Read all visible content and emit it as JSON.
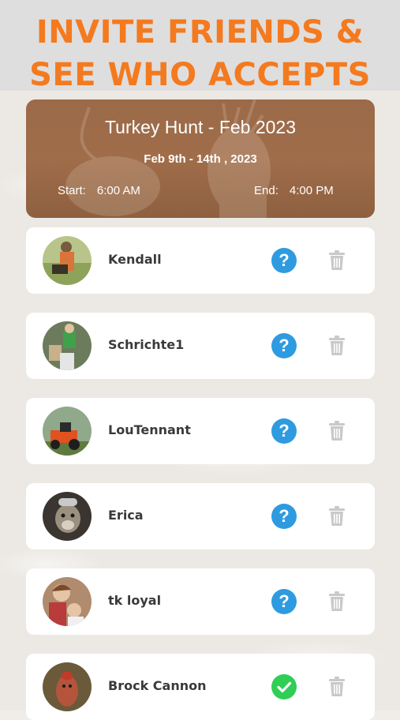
{
  "headline": {
    "line1": "INVITE FRIENDS &",
    "line2": "SEE WHO ACCEPTS",
    "color": "#f47a1f"
  },
  "event": {
    "title": "Turkey Hunt - Feb 2023",
    "dates": "Feb 9th - 14th , 2023",
    "start_label": "Start:",
    "start_time": "6:00 AM",
    "end_label": "End:",
    "end_time": "4:00 PM"
  },
  "invitees": [
    {
      "name": "Kendall",
      "status": "pending",
      "status_icon": "question-icon"
    },
    {
      "name": "Schrichte1",
      "status": "pending",
      "status_icon": "question-icon"
    },
    {
      "name": "LouTennant",
      "status": "pending",
      "status_icon": "question-icon"
    },
    {
      "name": "Erica",
      "status": "pending",
      "status_icon": "question-icon"
    },
    {
      "name": "tk loyal",
      "status": "pending",
      "status_icon": "question-icon"
    },
    {
      "name": "Brock Cannon",
      "status": "accepted",
      "status_icon": "checkmark-icon"
    }
  ],
  "colors": {
    "pending": "#2e9be0",
    "accepted": "#2fcf55",
    "trash": "#c9c9c9"
  }
}
